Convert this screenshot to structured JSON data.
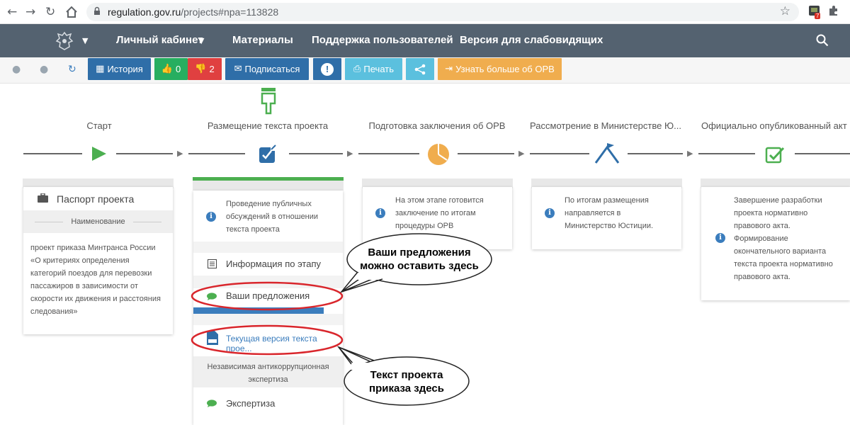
{
  "browser": {
    "url_host": "regulation.gov.ru",
    "url_path": "/projects#npa=113828",
    "ext_badge": "7"
  },
  "sitenav": {
    "items": [
      "Личный кабинет",
      "Материалы",
      "Поддержка пользователей",
      "Версия для слабовидящих"
    ]
  },
  "toolbar": {
    "history": "История",
    "likes": "0",
    "dislikes": "2",
    "subscribe": "Подписаться",
    "alert": "!",
    "print": "Печать",
    "learn_more": "Узнать больше об ОРВ"
  },
  "steps": [
    {
      "title": "Старт"
    },
    {
      "title": "Размещение текста проекта"
    },
    {
      "title": "Подготовка заключения об ОРВ"
    },
    {
      "title": "Рассмотрение в Министерстве Ю..."
    },
    {
      "title": "Официально опубликованный акт"
    }
  ],
  "card1": {
    "passport": "Паспорт проекта",
    "name_header": "Наименование",
    "name_lines": [
      "проект приказа Минтранса России",
      "«О критериях определения",
      "категорий поездов для перевозки",
      "пассажиров в зависимости от",
      "скорости их движения и расстояния",
      "следования»"
    ]
  },
  "card2": {
    "info_lines": [
      "Проведение публичных",
      "обсуждений в отношении",
      "текста проекта"
    ],
    "stage_info": "Информация по этапу",
    "proposals": "Ваши предложения",
    "current_text": "Текущая версия текста прое...",
    "anticorruption_lines": [
      "Независимая антикоррупционная",
      "экспертиза"
    ],
    "expertise": "Экспертиза"
  },
  "card3": {
    "info_lines": [
      "На этом этапе готовится",
      "заключение по итогам",
      "процедуры ОРВ"
    ]
  },
  "card4": {
    "info_lines": [
      "По итогам размещения",
      "направляется в",
      "Министерство Юстиции."
    ]
  },
  "card5": {
    "info_lines": [
      "Завершение разработки",
      "проекта нормативно",
      "правового акта.",
      "Формирование",
      "окончательного варианта",
      "текста проекта нормативно",
      "правового акта."
    ]
  },
  "callouts": {
    "proposals_lines": [
      "Ваши предложения",
      "можно оставить здесь"
    ],
    "text_lines": [
      "Текст проекта",
      "приказа здесь"
    ]
  },
  "colors": {
    "nav_bg": "#546270",
    "history_btn": "#2f6ea8",
    "like_btn": "#27ae60",
    "dislike_btn": "#e04040",
    "print_btn": "#5bc0de",
    "learn_btn": "#f0ad4e",
    "green_accent": "#4caf50",
    "annotation_red": "#d9262c"
  }
}
